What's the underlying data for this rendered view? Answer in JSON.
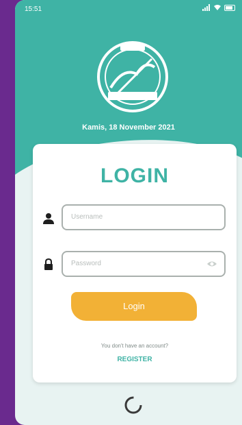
{
  "status_bar": {
    "time": "15:51",
    "icons": [
      "signal-icon",
      "wifi-icon",
      "battery-icon"
    ]
  },
  "header": {
    "date": "Kamis, 18 November 2021",
    "logo_icon": "organization-seal-logo"
  },
  "login_card": {
    "title": "LOGIN",
    "username": {
      "icon": "user-icon",
      "placeholder": "Username",
      "value": ""
    },
    "password": {
      "icon": "lock-icon",
      "placeholder": "Password",
      "value": "",
      "toggle_icon": "eye-icon"
    },
    "login_button_label": "Login",
    "no_account_text": "You don't have an account?",
    "register_label": "REGISTER"
  },
  "loading": {
    "icon": "loading-spinner-icon"
  },
  "colors": {
    "teal": "#3fb3a5",
    "orange": "#f2b136",
    "purple_bg": "#6a2a8e",
    "card_bg": "#ffffff",
    "page_bg": "#e8f3f2"
  }
}
